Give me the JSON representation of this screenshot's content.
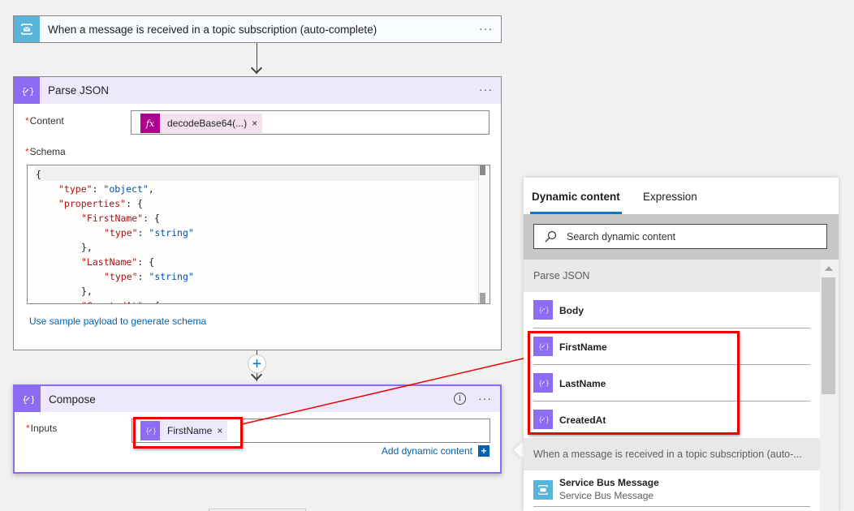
{
  "trigger": {
    "title": "When a message is received in a topic subscription (auto-complete)",
    "icon": "service-bus-icon",
    "menu": "···"
  },
  "parse_json": {
    "title": "Parse JSON",
    "icon": "variable-icon",
    "menu": "···",
    "content_label": "Content",
    "content_token": "decodeBase64(...)",
    "content_token_icon": "fx-icon",
    "schema_label": "Schema",
    "schema_lines": [
      {
        "indent": 0,
        "parts": [
          {
            "t": "p",
            "v": "{"
          }
        ]
      },
      {
        "indent": 1,
        "parts": [
          {
            "t": "k",
            "v": "\"type\""
          },
          {
            "t": "p",
            "v": ": "
          },
          {
            "t": "s",
            "v": "\"object\""
          },
          {
            "t": "p",
            "v": ","
          }
        ]
      },
      {
        "indent": 1,
        "parts": [
          {
            "t": "k",
            "v": "\"properties\""
          },
          {
            "t": "p",
            "v": ": {"
          }
        ]
      },
      {
        "indent": 2,
        "parts": [
          {
            "t": "k",
            "v": "\"FirstName\""
          },
          {
            "t": "p",
            "v": ": {"
          }
        ]
      },
      {
        "indent": 3,
        "parts": [
          {
            "t": "k",
            "v": "\"type\""
          },
          {
            "t": "p",
            "v": ": "
          },
          {
            "t": "s",
            "v": "\"string\""
          }
        ]
      },
      {
        "indent": 2,
        "parts": [
          {
            "t": "p",
            "v": "},"
          }
        ]
      },
      {
        "indent": 2,
        "parts": [
          {
            "t": "k",
            "v": "\"LastName\""
          },
          {
            "t": "p",
            "v": ": {"
          }
        ]
      },
      {
        "indent": 3,
        "parts": [
          {
            "t": "k",
            "v": "\"type\""
          },
          {
            "t": "p",
            "v": ": "
          },
          {
            "t": "s",
            "v": "\"string\""
          }
        ]
      },
      {
        "indent": 2,
        "parts": [
          {
            "t": "p",
            "v": "},"
          }
        ]
      },
      {
        "indent": 2,
        "parts": [
          {
            "t": "k",
            "v": "\"CreatedAt\""
          },
          {
            "t": "p",
            "v": ": {"
          }
        ]
      }
    ],
    "sample_link": "Use sample payload to generate schema"
  },
  "compose": {
    "title": "Compose",
    "icon": "variable-icon",
    "menu": "···",
    "inputs_label": "Inputs",
    "input_token": "FirstName",
    "add_dynamic": "Add dynamic content"
  },
  "dynamic_panel": {
    "tabs": [
      {
        "label": "Dynamic content",
        "active": true
      },
      {
        "label": "Expression",
        "active": false
      }
    ],
    "search_placeholder": "Search dynamic content",
    "sections": [
      {
        "title": "Parse JSON",
        "items": [
          {
            "name": "Body",
            "icon": "variable-icon"
          },
          {
            "name": "FirstName",
            "icon": "variable-icon"
          },
          {
            "name": "LastName",
            "icon": "variable-icon"
          },
          {
            "name": "CreatedAt",
            "icon": "variable-icon"
          }
        ]
      },
      {
        "title": "When a message is received in a topic subscription (auto-...",
        "items": [
          {
            "name": "Service Bus Message",
            "description": "Service Bus Message",
            "icon": "service-bus-icon"
          }
        ]
      }
    ]
  },
  "colors": {
    "variable": "#8c6cf4",
    "service_bus": "#59b4d9",
    "expression": "#ad008c",
    "accent": "#0078d4",
    "highlight": "#ee0000"
  }
}
